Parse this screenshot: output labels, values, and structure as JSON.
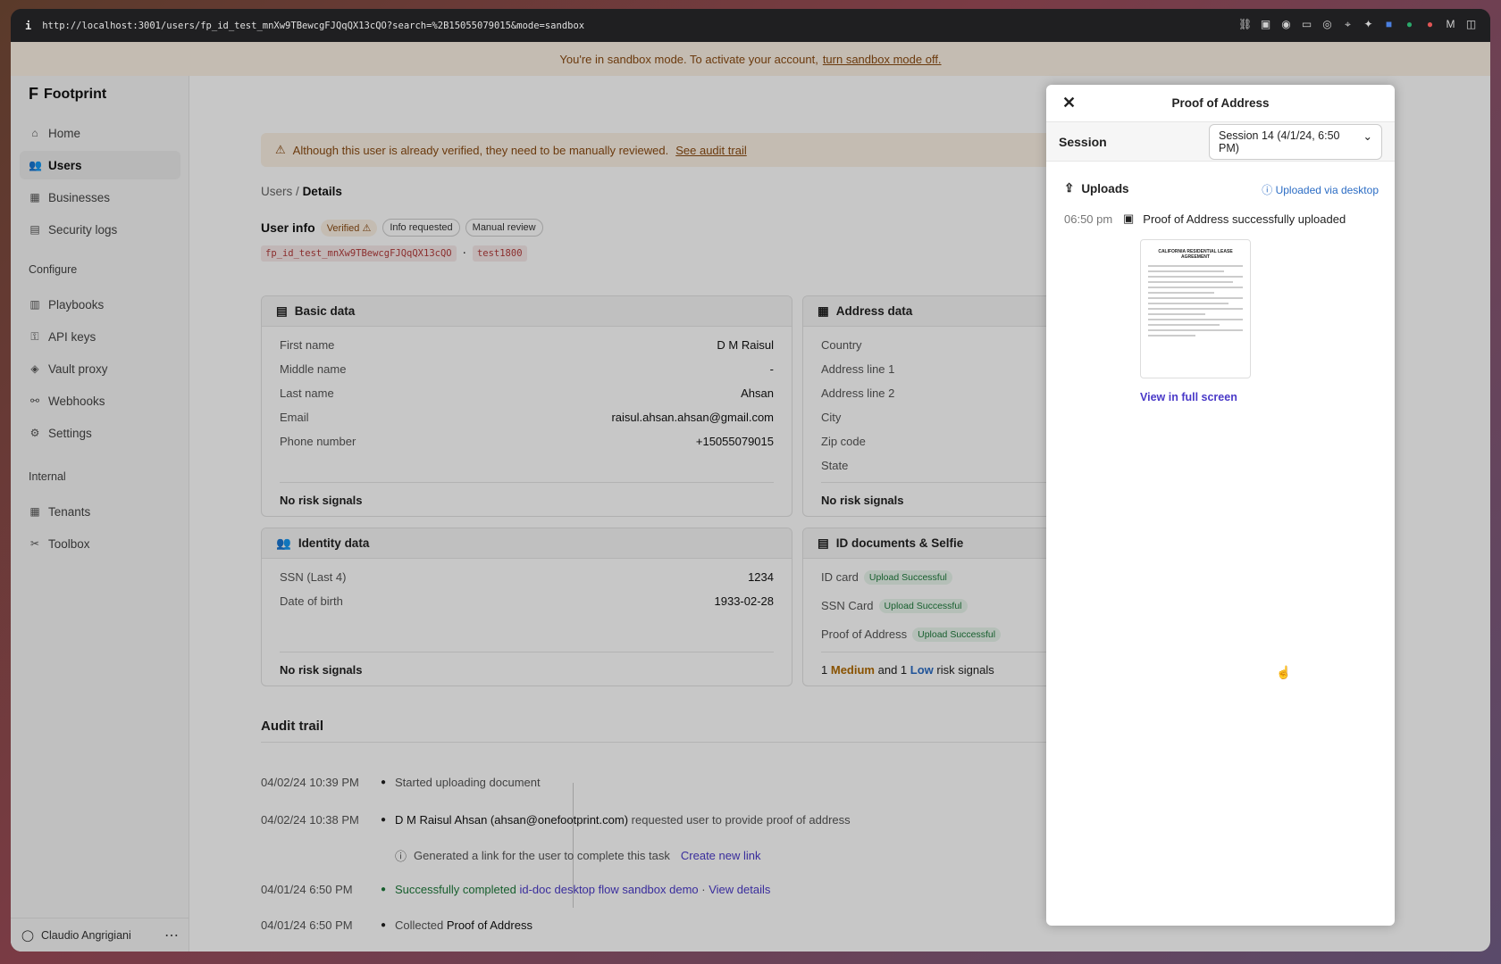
{
  "browser": {
    "info": "i",
    "url": "http://localhost:3001/users/fp_id_test_mnXw9TBewcgFJQqQX13cQO?search=%2B15055079015&mode=sandbox"
  },
  "banner": {
    "text": "You're in sandbox mode. To activate your account,",
    "link": "turn sandbox mode off."
  },
  "sidebar": {
    "brand": "Footprint",
    "items": [
      {
        "label": "Home"
      },
      {
        "label": "Users"
      },
      {
        "label": "Businesses"
      },
      {
        "label": "Security logs"
      }
    ],
    "configure_title": "Configure",
    "configure": [
      {
        "label": "Playbooks"
      },
      {
        "label": "API keys"
      },
      {
        "label": "Vault proxy"
      },
      {
        "label": "Webhooks"
      },
      {
        "label": "Settings"
      }
    ],
    "internal_title": "Internal",
    "internal": [
      {
        "label": "Tenants"
      },
      {
        "label": "Toolbox"
      }
    ],
    "user": "Claudio Angrigiani"
  },
  "alert": {
    "text": "Although this user is already verified, they need to be manually reviewed.",
    "link": "See audit trail"
  },
  "breadcrumb": {
    "root": "Users",
    "sep": "/",
    "current": "Details"
  },
  "user_info": {
    "title": "User info",
    "badges": [
      "Verified",
      "Info requested",
      "Manual review"
    ],
    "id": "fp_id_test_mnXw9TBewcgFJQqQX13cQO",
    "dot": "·",
    "tag": "test1800"
  },
  "basic": {
    "title": "Basic data",
    "rows": [
      {
        "k": "First name",
        "v": "D M Raisul"
      },
      {
        "k": "Middle name",
        "v": "-"
      },
      {
        "k": "Last name",
        "v": "Ahsan"
      },
      {
        "k": "Email",
        "v": "raisul.ahsan.ahsan@gmail.com"
      },
      {
        "k": "Phone number",
        "v": "+15055079015"
      }
    ],
    "foot": "No risk signals"
  },
  "address": {
    "title": "Address data",
    "rows": [
      "Country",
      "Address line 1",
      "Address line 2",
      "City",
      "Zip code",
      "State"
    ],
    "foot": "No risk signals"
  },
  "identity": {
    "title": "Identity data",
    "rows": [
      {
        "k": "SSN (Last 4)",
        "v": "1234"
      },
      {
        "k": "Date of birth",
        "v": "1933-02-28"
      }
    ],
    "foot": "No risk signals"
  },
  "docs": {
    "title": "ID documents & Selfie",
    "rows": [
      {
        "k": "ID card",
        "v": "Upload Successful"
      },
      {
        "k": "SSN Card",
        "v": "Upload Successful"
      },
      {
        "k": "Proof of Address",
        "v": "Upload Successful"
      }
    ],
    "foot": {
      "n1": "1",
      "medium": "Medium",
      "and": "and 1",
      "low": "Low",
      "rest": "risk signals"
    }
  },
  "audit": {
    "title": "Audit trail",
    "events": [
      {
        "date": "04/02/24 10:39 PM",
        "text": "Started uploading document"
      },
      {
        "date": "04/02/24 10:38 PM",
        "actor": "D M Raisul Ahsan (ahsan@onefootprint.com)",
        "text": "requested user to provide proof of address"
      },
      {
        "sub": "Generated a link for the user to complete this task",
        "link": "Create new link"
      },
      {
        "date": "04/01/24 6:50 PM",
        "text": "Successfully completed",
        "flow": "id-doc desktop flow sandbox demo",
        "link": "View details"
      },
      {
        "date": "04/01/24 6:50 PM",
        "text": "Collected",
        "actor": "Proof of Address"
      }
    ]
  },
  "panel": {
    "title": "Proof of Address",
    "session_label": "Session",
    "session_value": "Session 14 (4/1/24, 6:50 PM)",
    "uploads": "Uploads",
    "uploaded_via": "Uploaded via desktop",
    "event_time": "06:50 pm",
    "event_text": "Proof of Address successfully uploaded",
    "doc_title": "CALIFORNIA RESIDENTIAL LEASE AGREEMENT",
    "view_full": "View in full screen"
  }
}
